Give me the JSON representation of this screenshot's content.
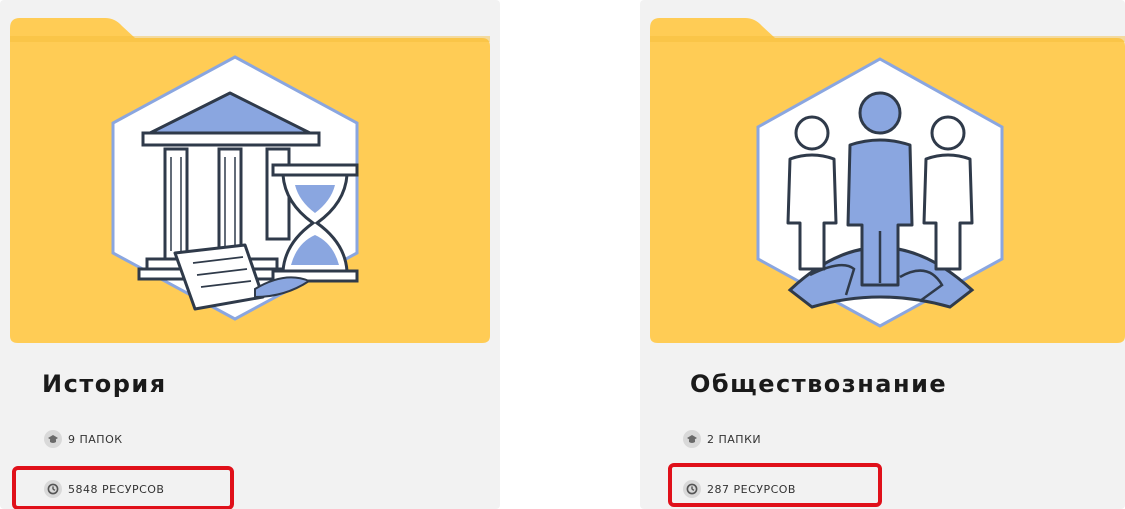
{
  "cards": [
    {
      "title": "История",
      "folders_label": "9 ПАПОК",
      "resources_label": "5848 РЕСУРСОВ",
      "illustration": "history-icon"
    },
    {
      "title": "Обществознание",
      "folders_label": "2 ПАПКИ",
      "resources_label": "287 РЕСУРСОВ",
      "illustration": "social-studies-icon"
    }
  ],
  "colors": {
    "folder": "#ffcc55",
    "folder_tab": "#f7c54c",
    "accent_blue": "#8aa6e0",
    "outline": "#2f3a4a",
    "highlight": "#e0101a"
  }
}
